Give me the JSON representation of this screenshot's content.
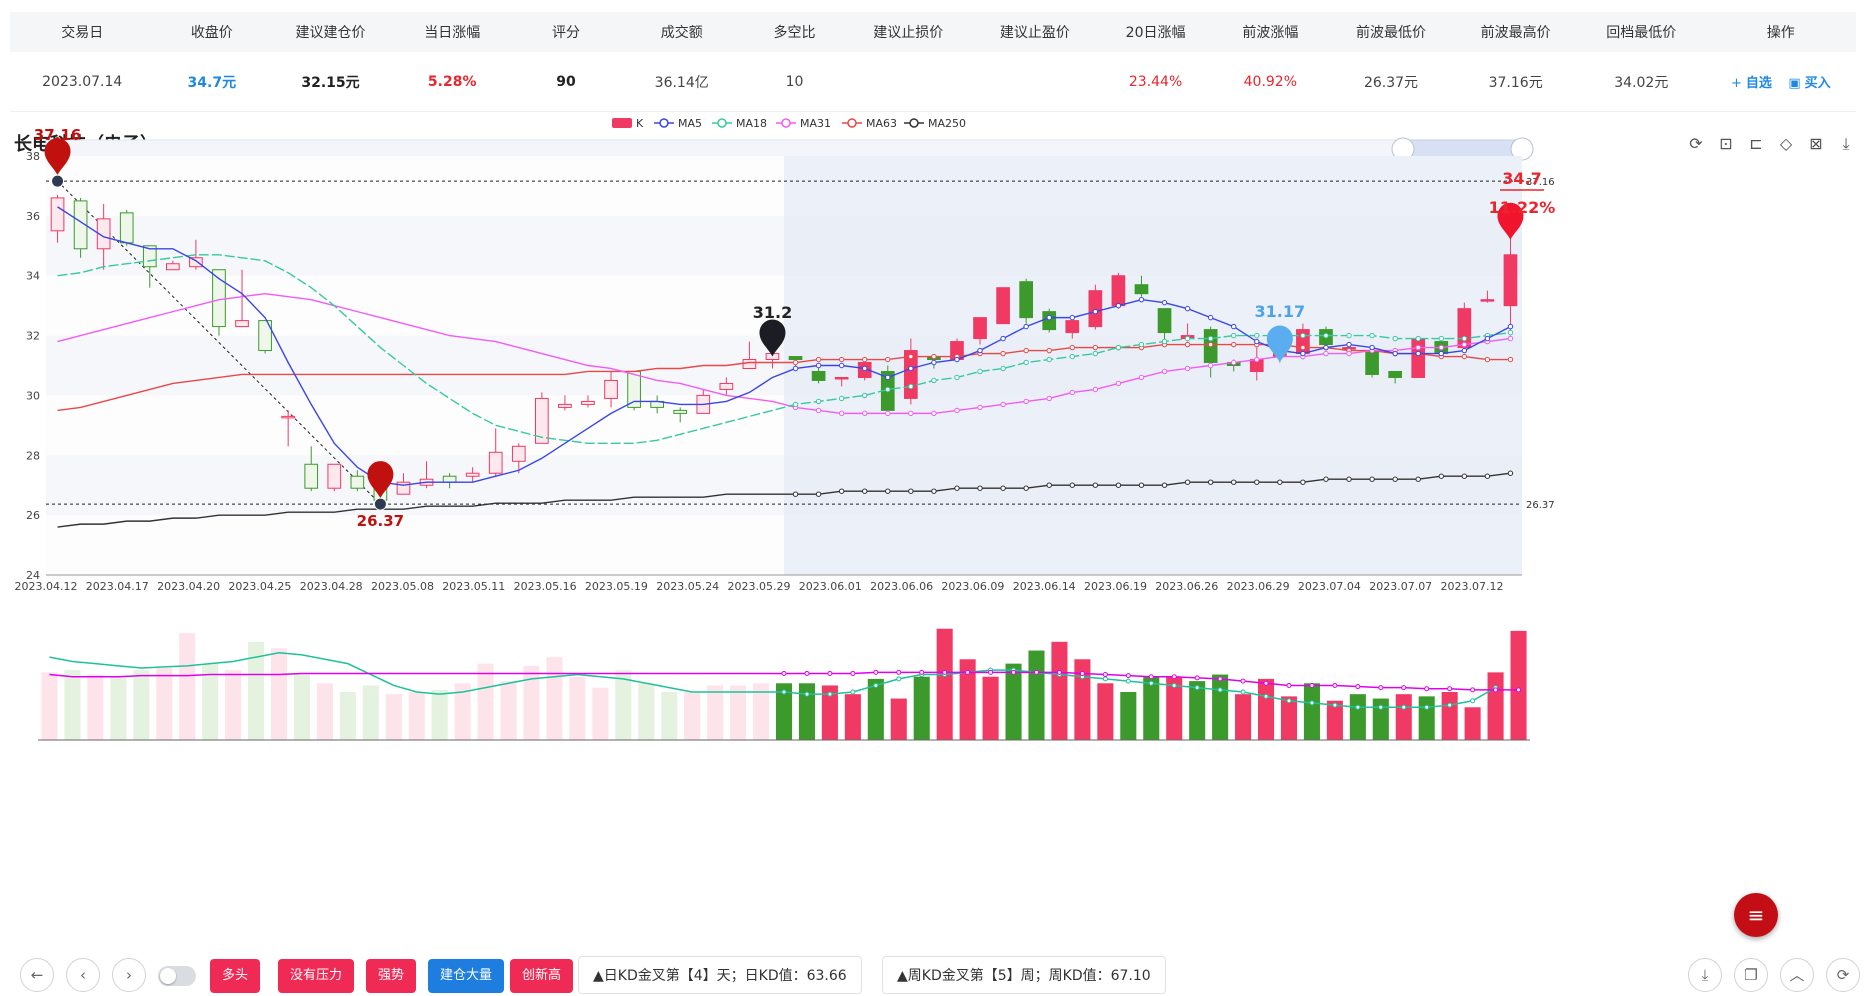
{
  "summary": {
    "headers": [
      "交易日",
      "收盘价",
      "建议建仓价",
      "当日涨幅",
      "评分",
      "成交额",
      "多空比",
      "建议止损价",
      "建议止盈价",
      "20日涨幅",
      "前波涨幅",
      "前波最低价",
      "前波最高价",
      "回档最低价",
      "操作"
    ],
    "values": [
      "2023.07.14",
      "34.7元",
      "32.15元",
      "5.28%",
      "90",
      "36.14亿",
      "10",
      "",
      "",
      "23.44%",
      "40.92%",
      "26.37元",
      "37.16元",
      "34.02元",
      ""
    ],
    "actions": {
      "watch": "自选",
      "buy": "买入"
    }
  },
  "chart": {
    "title": "长电科技（电子）",
    "legend": [
      "K",
      "MA5",
      "MA18",
      "MA31",
      "MA63",
      "MA250"
    ],
    "colors": {
      "up": "#f03a64",
      "down": "#3c9a2c",
      "ma5": "#3a45e8",
      "ma18": "#37c9a0",
      "ma31": "#f25cf5",
      "ma63": "#e84848",
      "ma250": "#333333"
    },
    "markers": {
      "high": "37.16",
      "low": "26.37",
      "pin_mid": "31.2",
      "pin_blue": "31.17",
      "last_price": "34.7",
      "last_change": "11.22%",
      "line_high": "37.16",
      "line_low": "26.37"
    }
  },
  "chart_data": {
    "type": "candlestick",
    "x_ticks": [
      "2023.04.12",
      "2023.04.17",
      "2023.04.20",
      "2023.04.25",
      "2023.04.28",
      "2023.05.08",
      "2023.05.11",
      "2023.05.16",
      "2023.05.19",
      "2023.05.24",
      "2023.05.29",
      "2023.06.01",
      "2023.06.06",
      "2023.06.09",
      "2023.06.14",
      "2023.06.19",
      "2023.06.26",
      "2023.06.29",
      "2023.07.04",
      "2023.07.07",
      "2023.07.12"
    ],
    "y_ticks": [
      24,
      26,
      28,
      30,
      32,
      34,
      36,
      38
    ],
    "ylim": [
      24,
      38
    ],
    "candles": [
      [
        35.5,
        36.6,
        35.1,
        36.7
      ],
      [
        36.5,
        34.9,
        34.6,
        36.6
      ],
      [
        34.9,
        35.9,
        34.2,
        36.4
      ],
      [
        36.1,
        35.1,
        35.0,
        36.2
      ],
      [
        35.0,
        34.3,
        33.6,
        35.0
      ],
      [
        34.2,
        34.4,
        34.2,
        34.5
      ],
      [
        34.3,
        34.6,
        34.2,
        35.2
      ],
      [
        34.2,
        32.3,
        32.0,
        34.2
      ],
      [
        32.3,
        32.5,
        32.3,
        34.2
      ],
      [
        32.5,
        31.5,
        31.4,
        32.5
      ],
      [
        29.3,
        29.3,
        28.3,
        29.5
      ],
      [
        27.7,
        26.9,
        26.8,
        28.3
      ],
      [
        26.9,
        27.7,
        26.8,
        27.7
      ],
      [
        27.3,
        26.9,
        26.8,
        27.5
      ],
      [
        27.1,
        26.5,
        26.4,
        27.2
      ],
      [
        26.7,
        27.1,
        26.7,
        27.4
      ],
      [
        27.0,
        27.2,
        26.9,
        27.8
      ],
      [
        27.3,
        27.1,
        26.9,
        27.4
      ],
      [
        27.3,
        27.4,
        27.1,
        27.6
      ],
      [
        27.4,
        28.1,
        27.3,
        28.9
      ],
      [
        27.8,
        28.3,
        27.4,
        28.4
      ],
      [
        28.4,
        29.9,
        28.4,
        30.1
      ],
      [
        29.6,
        29.7,
        29.5,
        30.0
      ],
      [
        29.7,
        29.8,
        29.6,
        30.0
      ],
      [
        29.9,
        30.5,
        29.6,
        30.8
      ],
      [
        30.8,
        29.6,
        29.5,
        30.8
      ],
      [
        29.8,
        29.6,
        29.4,
        30.0
      ],
      [
        29.5,
        29.4,
        29.1,
        29.6
      ],
      [
        29.4,
        30.0,
        29.4,
        30.2
      ],
      [
        30.2,
        30.4,
        30.0,
        30.6
      ],
      [
        30.9,
        31.2,
        30.9,
        31.8
      ],
      [
        31.2,
        31.4,
        30.9,
        31.5
      ],
      [
        31.3,
        31.2,
        30.9,
        31.3
      ],
      [
        30.8,
        30.5,
        30.4,
        31.0
      ],
      [
        30.6,
        30.6,
        30.3,
        30.6
      ],
      [
        30.6,
        31.1,
        30.5,
        31.1
      ],
      [
        30.8,
        29.5,
        29.5,
        31.0
      ],
      [
        29.9,
        31.5,
        29.7,
        31.9
      ],
      [
        31.3,
        31.2,
        30.9,
        31.3
      ],
      [
        31.2,
        31.8,
        31.2,
        31.9
      ],
      [
        31.9,
        32.6,
        31.7,
        32.6
      ],
      [
        32.4,
        33.6,
        32.4,
        33.6
      ],
      [
        33.8,
        32.6,
        32.4,
        33.9
      ],
      [
        32.8,
        32.2,
        32.1,
        32.9
      ],
      [
        32.1,
        32.5,
        31.9,
        32.5
      ],
      [
        32.3,
        33.5,
        32.2,
        33.7
      ],
      [
        33.0,
        34.0,
        32.9,
        34.1
      ],
      [
        33.7,
        33.4,
        33.3,
        34.0
      ],
      [
        32.9,
        32.1,
        31.8,
        32.9
      ],
      [
        31.9,
        32.0,
        31.8,
        32.4
      ],
      [
        32.2,
        31.1,
        30.6,
        32.3
      ],
      [
        31.1,
        31.0,
        30.8,
        31.2
      ],
      [
        30.8,
        31.2,
        30.5,
        31.6
      ],
      [
        31.3,
        31.6,
        31.1,
        31.8
      ],
      [
        31.4,
        32.2,
        31.2,
        32.4
      ],
      [
        32.2,
        31.7,
        31.6,
        32.3
      ],
      [
        31.6,
        31.6,
        31.4,
        31.7
      ],
      [
        31.5,
        30.7,
        30.6,
        31.5
      ],
      [
        30.8,
        30.6,
        30.4,
        30.8
      ],
      [
        30.6,
        31.9,
        30.6,
        31.9
      ],
      [
        31.8,
        31.4,
        31.4,
        31.9
      ],
      [
        31.6,
        32.9,
        31.5,
        33.1
      ],
      [
        33.2,
        33.2,
        33.1,
        33.5
      ],
      [
        33.0,
        34.7,
        32.0,
        35.3
      ]
    ],
    "ma5": [
      36.3,
      35.8,
      35.3,
      35.1,
      34.9,
      34.9,
      34.5,
      33.9,
      33.4,
      32.6,
      31.1,
      29.7,
      28.4,
      27.6,
      27.1,
      27.0,
      27.1,
      27.1,
      27.1,
      27.3,
      27.5,
      27.9,
      28.4,
      28.9,
      29.4,
      29.8,
      29.8,
      29.7,
      29.7,
      29.8,
      30.1,
      30.6,
      30.9,
      31.0,
      31.0,
      30.9,
      30.6,
      30.9,
      31.1,
      31.2,
      31.5,
      31.9,
      32.3,
      32.6,
      32.6,
      32.8,
      33.0,
      33.2,
      33.1,
      32.9,
      32.6,
      32.3,
      31.8,
      31.5,
      31.4,
      31.6,
      31.7,
      31.6,
      31.4,
      31.4,
      31.4,
      31.5,
      31.9,
      32.3
    ],
    "ma18": [
      34.0,
      34.1,
      34.3,
      34.4,
      34.5,
      34.6,
      34.7,
      34.7,
      34.6,
      34.5,
      34.1,
      33.6,
      33.0,
      32.3,
      31.6,
      31.0,
      30.4,
      29.9,
      29.4,
      29.0,
      28.8,
      28.6,
      28.5,
      28.4,
      28.4,
      28.4,
      28.5,
      28.7,
      28.9,
      29.1,
      29.3,
      29.5,
      29.7,
      29.8,
      29.9,
      30.0,
      30.2,
      30.3,
      30.5,
      30.6,
      30.8,
      30.9,
      31.1,
      31.2,
      31.3,
      31.4,
      31.6,
      31.7,
      31.8,
      31.9,
      31.9,
      32.0,
      32.0,
      32.0,
      32.0,
      32.0,
      32.0,
      32.0,
      31.9,
      31.9,
      31.9,
      31.9,
      32.0,
      32.1
    ],
    "ma31": [
      31.8,
      32.0,
      32.2,
      32.4,
      32.6,
      32.8,
      33.0,
      33.2,
      33.3,
      33.4,
      33.3,
      33.2,
      33.0,
      32.8,
      32.6,
      32.4,
      32.2,
      32.0,
      31.9,
      31.8,
      31.6,
      31.4,
      31.2,
      31.0,
      30.9,
      30.7,
      30.5,
      30.4,
      30.2,
      30.0,
      29.9,
      29.8,
      29.6,
      29.5,
      29.4,
      29.4,
      29.4,
      29.4,
      29.4,
      29.5,
      29.6,
      29.7,
      29.8,
      29.9,
      30.1,
      30.2,
      30.4,
      30.6,
      30.8,
      30.9,
      31.0,
      31.1,
      31.2,
      31.3,
      31.3,
      31.4,
      31.4,
      31.5,
      31.5,
      31.6,
      31.6,
      31.7,
      31.8,
      31.9
    ],
    "ma63": [
      29.5,
      29.6,
      29.8,
      30.0,
      30.2,
      30.4,
      30.5,
      30.6,
      30.7,
      30.7,
      30.7,
      30.7,
      30.7,
      30.7,
      30.7,
      30.7,
      30.7,
      30.7,
      30.7,
      30.7,
      30.7,
      30.7,
      30.7,
      30.8,
      30.8,
      30.8,
      30.9,
      30.9,
      31.0,
      31.0,
      31.1,
      31.1,
      31.1,
      31.2,
      31.2,
      31.2,
      31.2,
      31.3,
      31.3,
      31.3,
      31.4,
      31.4,
      31.5,
      31.5,
      31.6,
      31.6,
      31.6,
      31.6,
      31.7,
      31.7,
      31.7,
      31.7,
      31.7,
      31.7,
      31.6,
      31.6,
      31.5,
      31.5,
      31.4,
      31.4,
      31.3,
      31.3,
      31.2,
      31.2
    ],
    "ma250": [
      25.6,
      25.7,
      25.7,
      25.8,
      25.8,
      25.9,
      25.9,
      26.0,
      26.0,
      26.0,
      26.1,
      26.1,
      26.1,
      26.2,
      26.2,
      26.2,
      26.3,
      26.3,
      26.3,
      26.4,
      26.4,
      26.4,
      26.5,
      26.5,
      26.5,
      26.6,
      26.6,
      26.6,
      26.6,
      26.7,
      26.7,
      26.7,
      26.7,
      26.7,
      26.8,
      26.8,
      26.8,
      26.8,
      26.8,
      26.9,
      26.9,
      26.9,
      26.9,
      27.0,
      27.0,
      27.0,
      27.0,
      27.0,
      27.0,
      27.1,
      27.1,
      27.1,
      27.1,
      27.1,
      27.1,
      27.2,
      27.2,
      27.2,
      27.2,
      27.2,
      27.3,
      27.3,
      27.3,
      27.4
    ],
    "volume": [
      62,
      64,
      60,
      58,
      64,
      66,
      98,
      70,
      64,
      90,
      84,
      60,
      52,
      44,
      50,
      42,
      44,
      46,
      52,
      70,
      54,
      68,
      76,
      58,
      48,
      64,
      52,
      44,
      44,
      50,
      50,
      52,
      52,
      52,
      50,
      42,
      56,
      38,
      58,
      102,
      74,
      58,
      70,
      82,
      90,
      74,
      52,
      44,
      58,
      58,
      54,
      60,
      42,
      56,
      40,
      52,
      36,
      42,
      38,
      42,
      40,
      44,
      30,
      62,
      100
    ],
    "vol_ma1": [
      76,
      72,
      70,
      68,
      66,
      67,
      68,
      70,
      72,
      76,
      80,
      78,
      74,
      70,
      60,
      50,
      44,
      42,
      44,
      48,
      52,
      56,
      58,
      60,
      58,
      56,
      52,
      48,
      44,
      44,
      44,
      44,
      44,
      42,
      42,
      44,
      50,
      56,
      60,
      60,
      62,
      64,
      64,
      62,
      60,
      58,
      56,
      54,
      52,
      50,
      48,
      46,
      44,
      40,
      36,
      34,
      32,
      30,
      30,
      30,
      30,
      32,
      36,
      48
    ],
    "vol_ma2": [
      60,
      58,
      58,
      58,
      59,
      59,
      59,
      60,
      60,
      60,
      60,
      61,
      61,
      61,
      61,
      61,
      61,
      61,
      61,
      61,
      61,
      61,
      61,
      61,
      61,
      61,
      61,
      61,
      61,
      61,
      61,
      61,
      61,
      61,
      61,
      61,
      62,
      62,
      62,
      62,
      62,
      62,
      62,
      62,
      62,
      61,
      60,
      59,
      58,
      58,
      57,
      56,
      54,
      52,
      50,
      50,
      50,
      49,
      48,
      48,
      47,
      47,
      46,
      46,
      46
    ]
  },
  "bottom": {
    "tags": [
      "多头",
      "没有压力",
      "强势",
      "建仓大量",
      "创新高"
    ],
    "info1": "▲日KD金叉第【4】天；日KD值：63.66",
    "info2": "▲周KD金叉第【5】周；周KD值：67.10"
  }
}
